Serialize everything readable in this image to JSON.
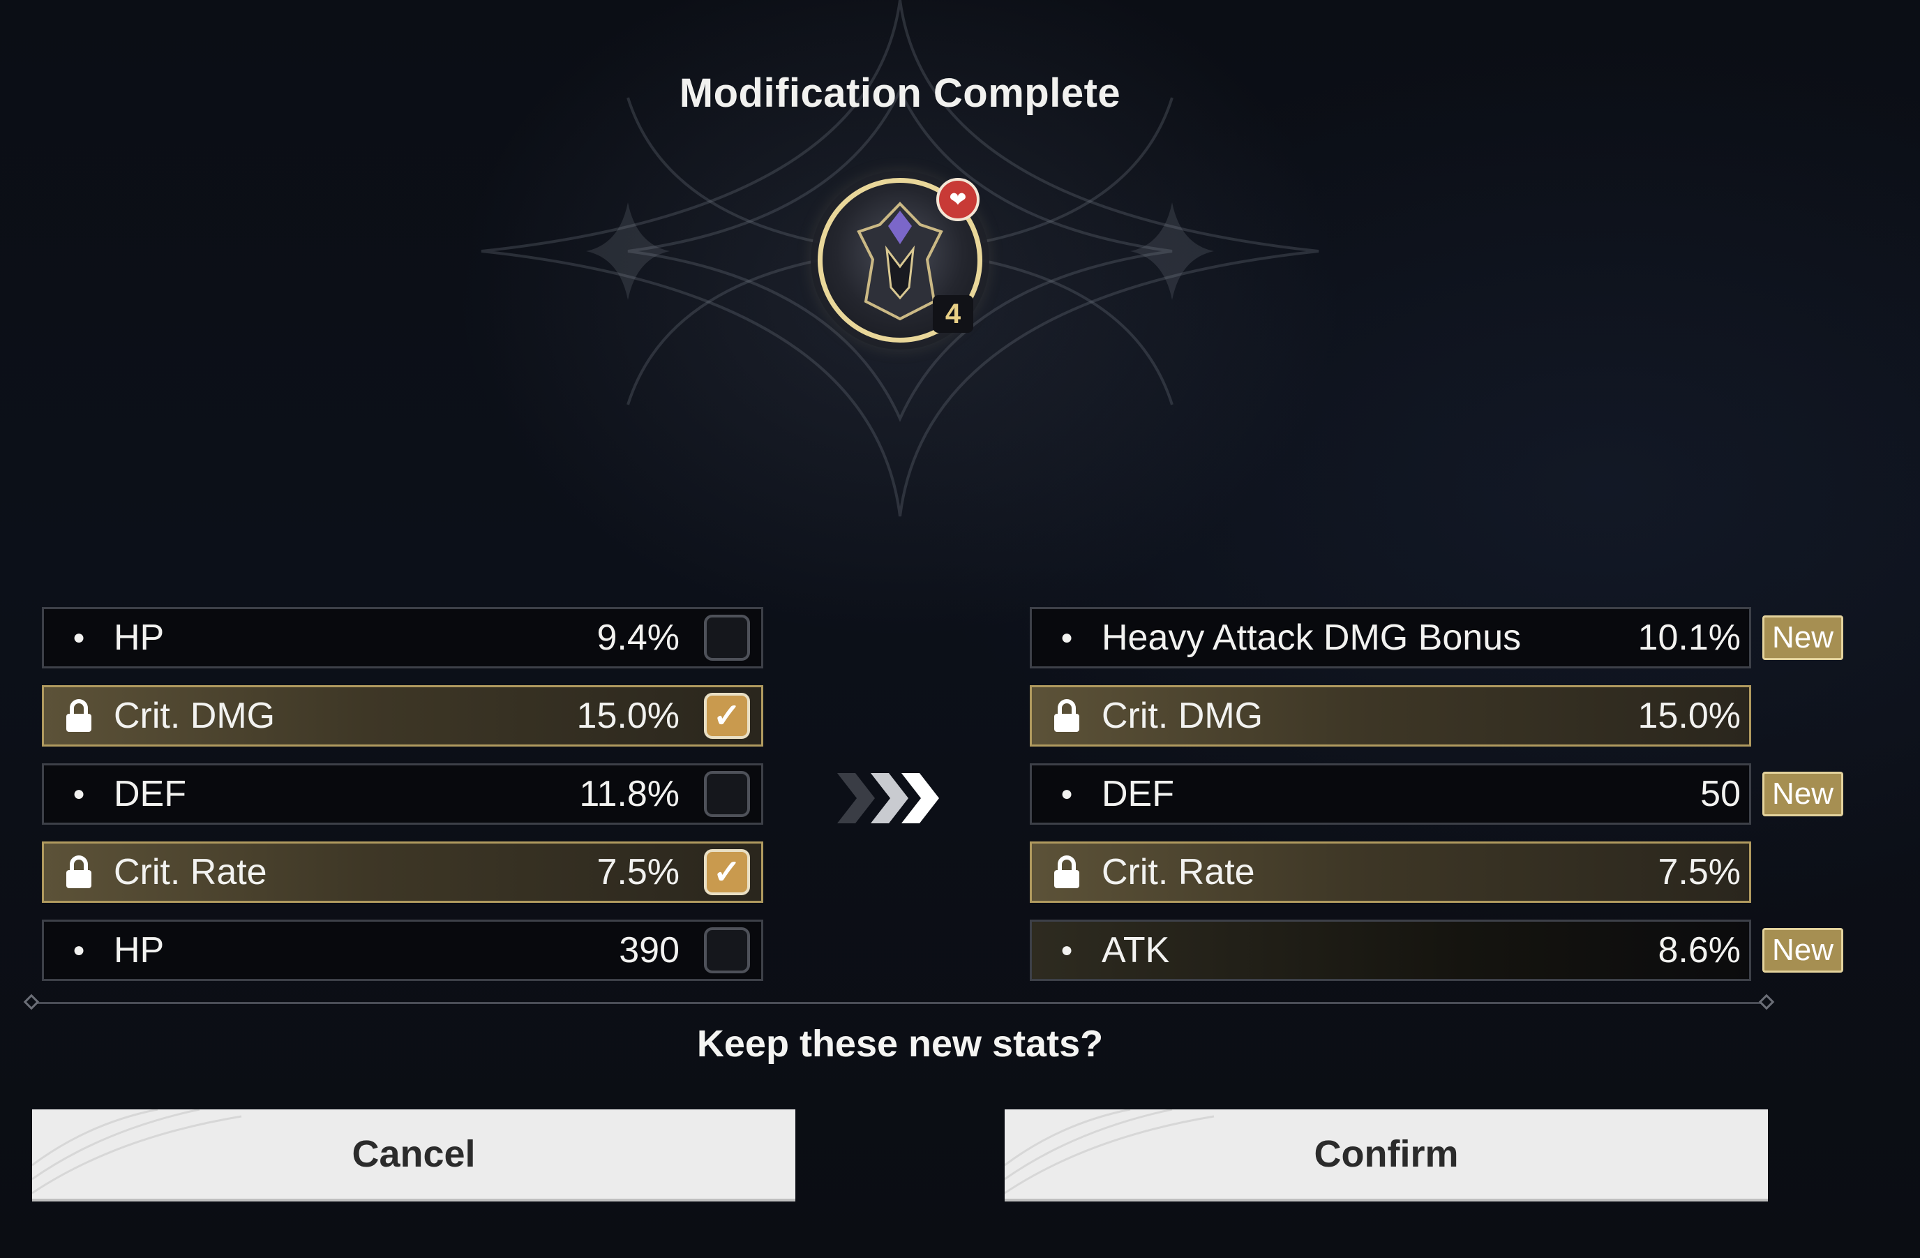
{
  "dialog": {
    "title": "Modification Complete",
    "prompt": "Keep these new stats?"
  },
  "item": {
    "level": "4"
  },
  "old_stats": [
    {
      "name": "HP",
      "value": "9.4%",
      "locked": false,
      "checked": false
    },
    {
      "name": "Crit. DMG",
      "value": "15.0%",
      "locked": true,
      "checked": true
    },
    {
      "name": "DEF",
      "value": "11.8%",
      "locked": false,
      "checked": false
    },
    {
      "name": "Crit. Rate",
      "value": "7.5%",
      "locked": true,
      "checked": true
    },
    {
      "name": "HP",
      "value": "390",
      "locked": false,
      "checked": false
    }
  ],
  "new_stats": [
    {
      "name": "Heavy Attack DMG Bonus",
      "value": "10.1%",
      "locked": false,
      "badge": "New"
    },
    {
      "name": "Crit. DMG",
      "value": "15.0%",
      "locked": true,
      "badge": ""
    },
    {
      "name": "DEF",
      "value": "50",
      "locked": false,
      "badge": "New"
    },
    {
      "name": "Crit. Rate",
      "value": "7.5%",
      "locked": true,
      "badge": ""
    },
    {
      "name": "ATK",
      "value": "8.6%",
      "locked": false,
      "badge": "New"
    }
  ],
  "buttons": {
    "cancel": "Cancel",
    "confirm": "Confirm"
  },
  "icons": {
    "lock": "lock-icon",
    "check": "checkmark-icon",
    "arrow": "double-chevron-right-icon",
    "heart": "heart-icon"
  },
  "colors": {
    "accent_gold": "#c99a4e",
    "badge_gold": "#a68f52",
    "locked_row": "#5c5238"
  }
}
